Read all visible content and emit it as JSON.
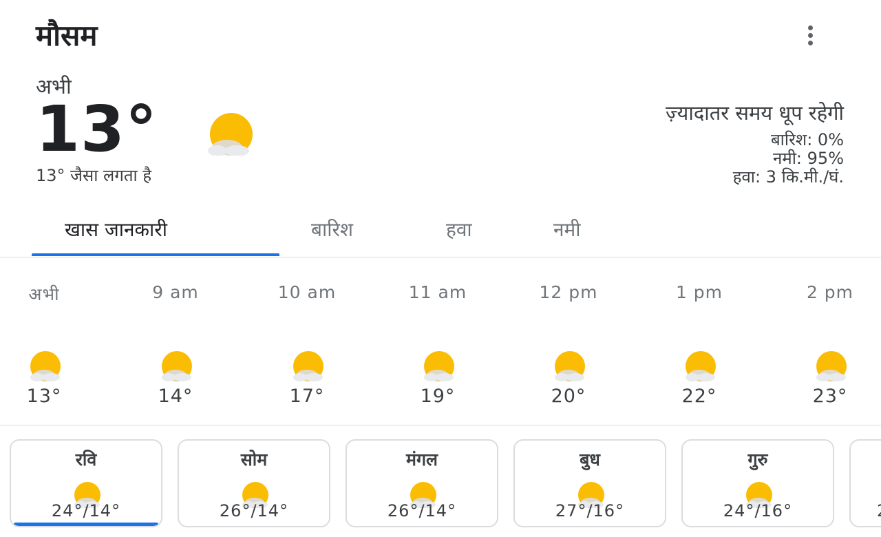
{
  "header": {
    "title": "मौसम"
  },
  "current": {
    "label": "अभी",
    "temp": "13°",
    "feels_like": "13° जैसा लगता है",
    "summary": "ज़्यादातर समय धूप रहेगी",
    "rain": "बारिश: 0%",
    "humidity": "नमी: 95%",
    "wind": "हवा: 3 कि.मी./घं.",
    "icon": "partly-sunny-icon"
  },
  "tabs": [
    {
      "label": "खास जानकारी"
    },
    {
      "label": "बारिश"
    },
    {
      "label": "हवा"
    },
    {
      "label": "नमी"
    }
  ],
  "active_tab": "खास जानकारी",
  "hourly": [
    {
      "time": "अभी",
      "temp": "13°"
    },
    {
      "time": "9 am",
      "temp": "14°"
    },
    {
      "time": "10 am",
      "temp": "17°"
    },
    {
      "time": "11 am",
      "temp": "19°"
    },
    {
      "time": "12 pm",
      "temp": "20°"
    },
    {
      "time": "1 pm",
      "temp": "22°"
    },
    {
      "time": "2 pm",
      "temp": "23°"
    }
  ],
  "daily": [
    {
      "day": "रवि",
      "range": "24°/14°"
    },
    {
      "day": "सोम",
      "range": "26°/14°"
    },
    {
      "day": "मंगल",
      "range": "26°/14°"
    },
    {
      "day": "बुध",
      "range": "27°/16°"
    },
    {
      "day": "गुरु",
      "range": "24°/16°"
    }
  ],
  "daily_partial_range": "2",
  "colors": {
    "sun": "#fbbc04",
    "cloud": "#dadce0",
    "accent": "#1a73e8",
    "divider": "#dadce0"
  }
}
